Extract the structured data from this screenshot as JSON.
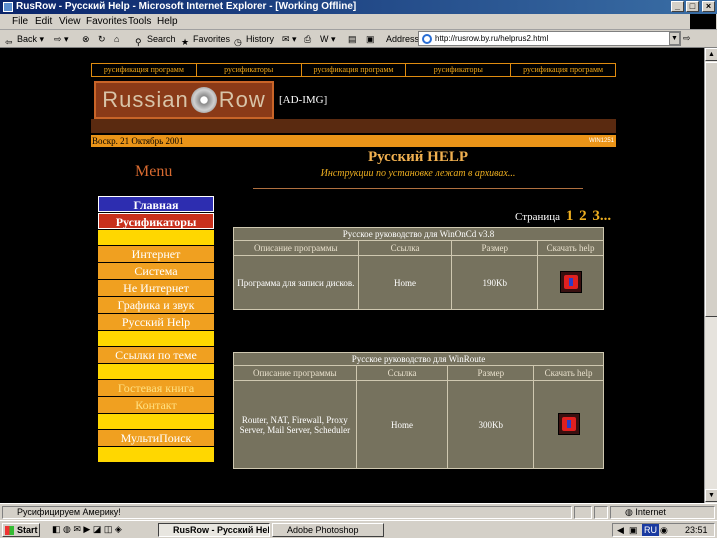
{
  "window": {
    "title": "RusRow - Русский Help - Microsoft Internet Explorer - [Working Offline]"
  },
  "menubar": [
    "File",
    "Edit",
    "View",
    "Favorites",
    "Tools",
    "Help"
  ],
  "toolbar": {
    "back": "Back",
    "search": "Search",
    "favorites": "Favorites",
    "history": "History",
    "address_label": "Address",
    "address_value": "http://rusrow.by.ru/helprus2.html",
    "go": "Go"
  },
  "page": {
    "topnav": [
      "русификация программ",
      "русификаторы",
      "русификация программ",
      "русификаторы",
      "русификация программ"
    ],
    "logo": {
      "left": "Russian",
      "right": "Row",
      "disc_text": "rusrow.by.ru"
    },
    "adimg": "[AD-IMG]",
    "date": "Воскр. 21 Октябрь 2001",
    "corner": "WIN1251",
    "menu_title": "Menu",
    "title": "Русский HELP",
    "subtitle": "Инструкции по установке лежат в архивах...",
    "pager_label": "Страница",
    "pages": [
      "1",
      "2",
      "3..."
    ],
    "nav": [
      {
        "label": "Главная",
        "style": "blue"
      },
      {
        "label": "Русификаторы",
        "style": "red"
      },
      {
        "label": "",
        "style": "yellow"
      },
      {
        "label": "Интернет",
        "style": "orange"
      },
      {
        "label": "Система",
        "style": "orange"
      },
      {
        "label": "Не Интернет",
        "style": "orange"
      },
      {
        "label": "Графика и звук",
        "style": "orange"
      },
      {
        "label": "Русский Help",
        "style": "orange"
      },
      {
        "label": "",
        "style": "yellow"
      },
      {
        "label": "Ссылки по теме",
        "style": "orange"
      },
      {
        "label": "",
        "style": "yellow"
      },
      {
        "label": "Гостевая книга",
        "style": "dim"
      },
      {
        "label": "Контакт",
        "style": "dim"
      },
      {
        "label": "",
        "style": "yellow"
      },
      {
        "label": "МультиПоиск",
        "style": "orange"
      },
      {
        "label": "",
        "style": "yellow"
      }
    ],
    "table_headers": [
      "Описание программы",
      "Ссылка",
      "Размер",
      "Скачать help"
    ],
    "tables": [
      {
        "caption": "Русское руководство для WinOnCd v3.8",
        "description": "Программа для записи дисков.",
        "link": "Home",
        "size": "190Kb"
      },
      {
        "caption": "Русское руководство для WinRoute",
        "description": "Router, NAT, Firewall, Proxy Server, Mail Server, Scheduler",
        "link": "Home",
        "size": "300Kb"
      }
    ]
  },
  "status": {
    "text": "Русифицируем Америку!",
    "zone": "Internet"
  },
  "taskbar": {
    "start": "Start",
    "tasks": [
      "RusRow - Русский Hel...",
      "Adobe Photoshop"
    ],
    "lang": "RU",
    "clock": "23:51"
  }
}
